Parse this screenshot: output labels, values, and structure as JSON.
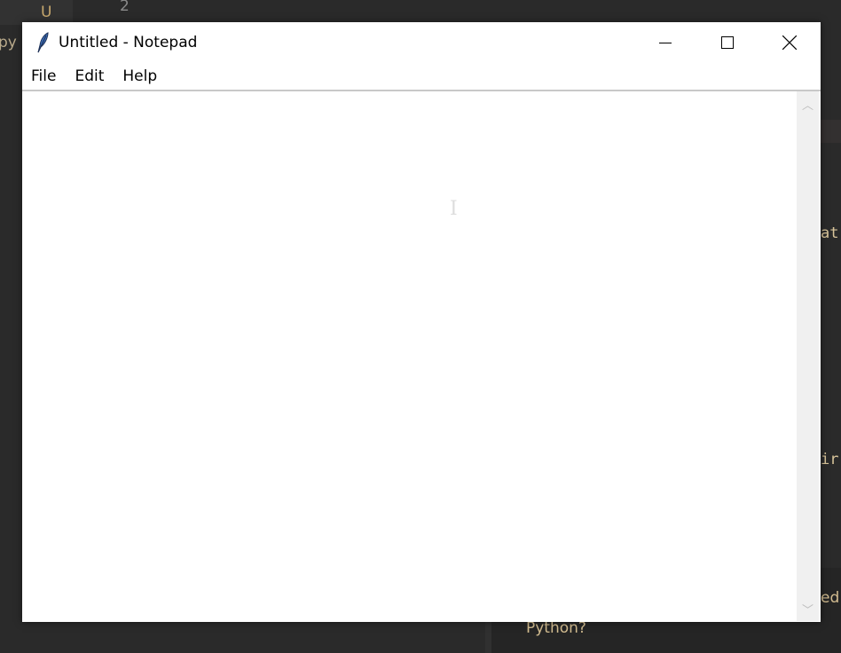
{
  "window": {
    "title": "Untitled - Notepad",
    "icon": "feather-icon"
  },
  "menu": {
    "items": [
      "File",
      "Edit",
      "Help"
    ]
  },
  "editor": {
    "content": ""
  },
  "background": {
    "tab_letter": "U",
    "line_number": "2",
    "left_fragment": "py",
    "right_fragments": [
      "at",
      "ir",
      "ed"
    ],
    "panel_text": "Python?"
  }
}
